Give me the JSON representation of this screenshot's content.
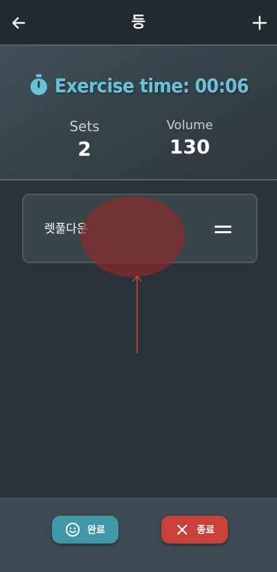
{
  "app_bar": {
    "title": "등",
    "back_icon": "arrow-left-icon",
    "add_icon": "plus-icon"
  },
  "summary": {
    "exercise_time_label": "Exercise time:",
    "exercise_time_value": "00:06",
    "sets_label": "Sets",
    "sets_value": "2",
    "volume_label": "Volume",
    "volume_value": "130",
    "accent_color": "#69c2d8"
  },
  "exercises": [
    {
      "name": "렛풀다운",
      "drag_icon": "drag-handle-icon"
    }
  ],
  "bottom_bar": {
    "complete_label": "완료",
    "complete_icon": "smiley-icon",
    "complete_color": "#3f98a5",
    "end_label": "종료",
    "end_icon": "close-icon",
    "end_color": "#c9413a"
  }
}
